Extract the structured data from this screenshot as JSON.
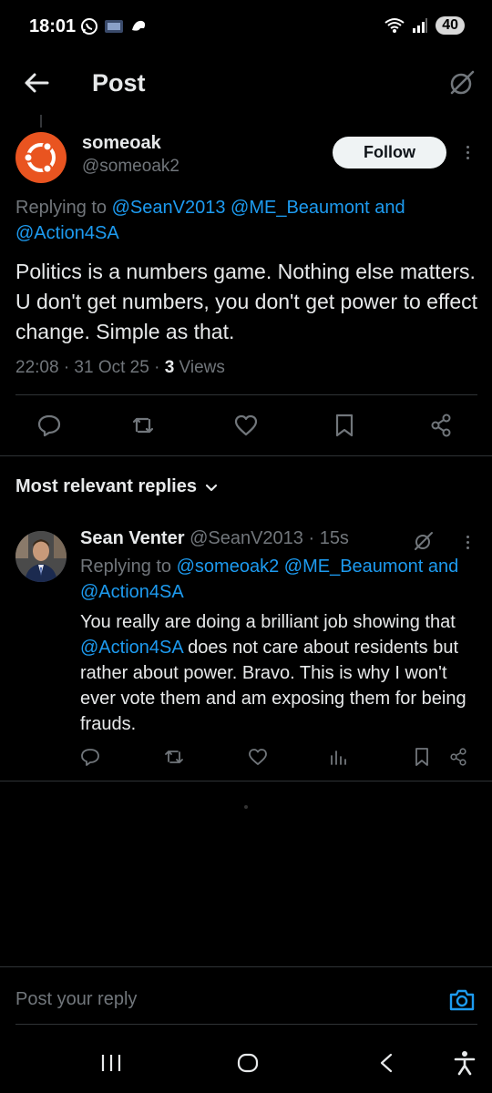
{
  "status_bar": {
    "time": "18:01",
    "battery": "40"
  },
  "header": {
    "title": "Post"
  },
  "post": {
    "author_name": "someoak",
    "author_handle": "@someoak2",
    "follow_label": "Follow",
    "replying_prefix": "Replying to ",
    "replying_mention1": "@SeanV2013",
    "replying_mention2": "@ME_Beaumont",
    "replying_and": " and",
    "replying_mention3": "@Action4SA",
    "text": "Politics is a numbers game. Nothing else matters. U don't get numbers, you don't get power to effect change. Simple as that.",
    "timestamp": "22:08 · 31 Oct 25 · ",
    "views_count": "3",
    "views_label": " Views"
  },
  "replies_header": {
    "label": "Most relevant replies"
  },
  "reply": {
    "name": "Sean Venter",
    "handle_time": " @SeanV2013 · 15s",
    "replying_prefix": "Replying to ",
    "replying_mention1": "@someoak2",
    "replying_mention2": "@ME_Beaumont",
    "replying_and": " and",
    "replying_mention3": "@Action4SA",
    "text_before": "You really are doing a brilliant job showing that ",
    "text_mention": "@Action4SA",
    "text_after": " does not care about residents but rather about power. Bravo. This is why I won't ever vote them and am exposing them for being frauds."
  },
  "composer": {
    "placeholder": "Post your reply"
  },
  "colors": {
    "link": "#1d9bf0",
    "muted": "#71767b",
    "text": "#e7e9ea",
    "ubuntu_orange": "#e95420"
  }
}
